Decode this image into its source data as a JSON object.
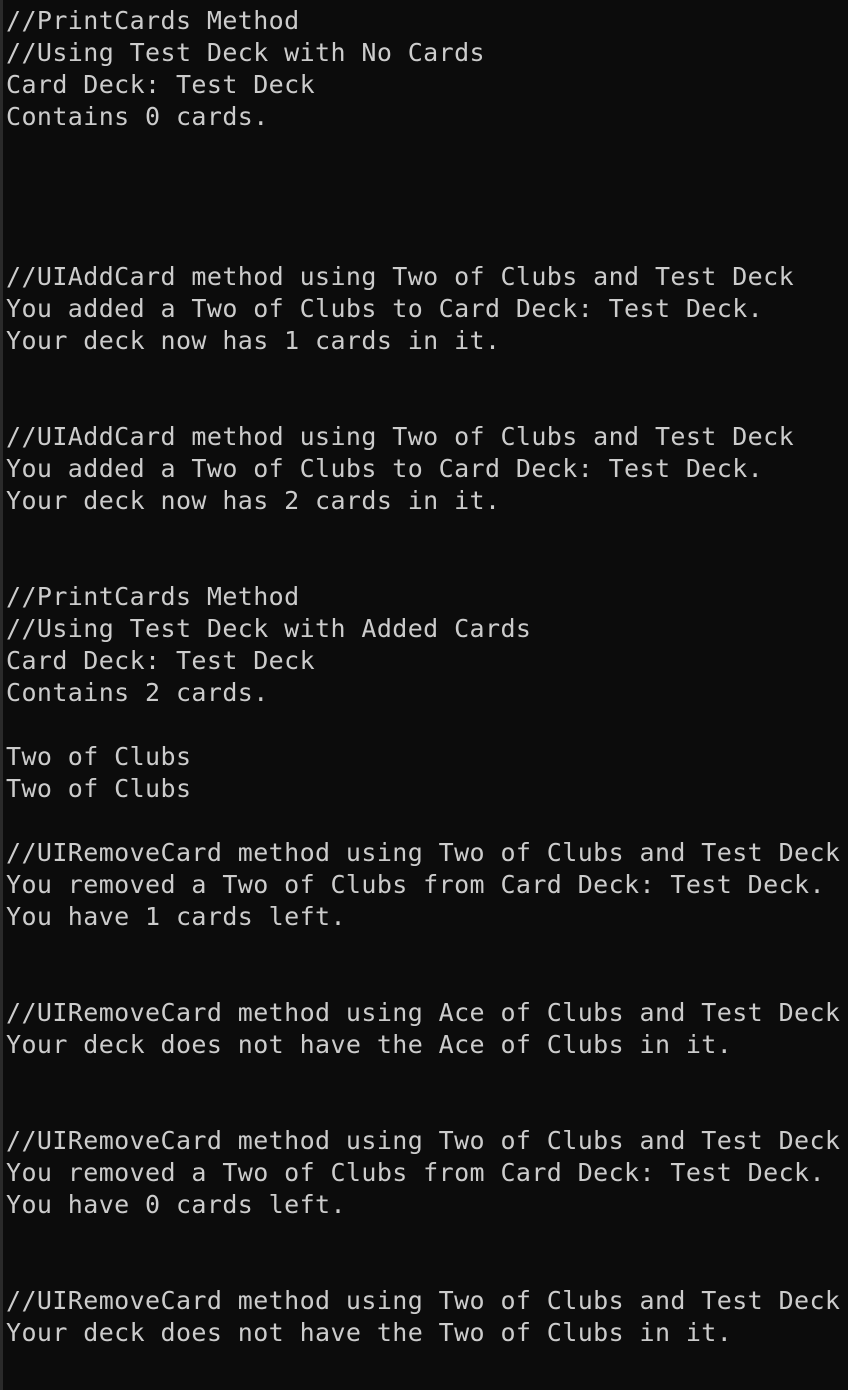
{
  "console": {
    "lines": [
      "//PrintCards Method",
      "//Using Test Deck with No Cards",
      "Card Deck: Test Deck",
      "Contains 0 cards.",
      "",
      "",
      "",
      "",
      "//UIAddCard method using Two of Clubs and Test Deck",
      "You added a Two of Clubs to Card Deck: Test Deck.",
      "Your deck now has 1 cards in it.",
      "",
      "",
      "//UIAddCard method using Two of Clubs and Test Deck",
      "You added a Two of Clubs to Card Deck: Test Deck.",
      "Your deck now has 2 cards in it.",
      "",
      "",
      "//PrintCards Method",
      "//Using Test Deck with Added Cards",
      "Card Deck: Test Deck",
      "Contains 2 cards.",
      "",
      "Two of Clubs",
      "Two of Clubs",
      "",
      "//UIRemoveCard method using Two of Clubs and Test Deck",
      "You removed a Two of Clubs from Card Deck: Test Deck.",
      "You have 1 cards left.",
      "",
      "",
      "//UIRemoveCard method using Ace of Clubs and Test Deck",
      "Your deck does not have the Ace of Clubs in it.",
      "",
      "",
      "//UIRemoveCard method using Two of Clubs and Test Deck",
      "You removed a Two of Clubs from Card Deck: Test Deck.",
      "You have 0 cards left.",
      "",
      "",
      "//UIRemoveCard method using Two of Clubs and Test Deck",
      "Your deck does not have the Two of Clubs in it."
    ]
  },
  "colors": {
    "background": "#0c0c0c",
    "text": "#cccccc"
  }
}
